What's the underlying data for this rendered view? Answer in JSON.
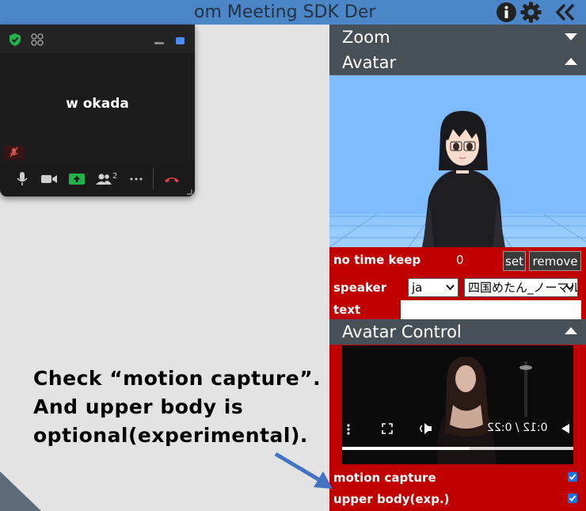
{
  "window": {
    "title": "om Meeting SDK Der",
    "icons": [
      "info-icon",
      "gear-icon",
      "double-chevron-left-icon"
    ]
  },
  "zoom_window": {
    "participant_name": "w okada",
    "participant_count": "2",
    "icons": [
      "shield-check-icon",
      "grid-view-icon",
      "minimize-icon",
      "maximize-icon",
      "muted-mic-icon",
      "mic-icon",
      "video-camera-icon",
      "share-screen-icon",
      "participants-icon",
      "more-icon",
      "end-call-icon"
    ],
    "colors": {
      "shield": "#22b24c",
      "share": "#22b24c",
      "end_call": "#e8453c"
    }
  },
  "panel": {
    "zoom_header": "Zoom",
    "avatar_header": "Avatar",
    "time_keep_label": "no time keep",
    "time_keep_value": "0",
    "set_button": "set",
    "remove_button": "remove",
    "speaker_label": "speaker",
    "speaker_lang": "ja",
    "speaker_voice": "四国めたん_ノーマル",
    "text_label": "text",
    "text_value": "",
    "avatar_control_header": "Avatar Control",
    "video_time": "0:12 / 0:22",
    "video_progress": 0.55,
    "motion_capture_label": "motion capture",
    "motion_capture_checked": true,
    "upper_body_label": "upper body(exp.)",
    "upper_body_checked": true,
    "colors": {
      "panel_bg": "#c00000",
      "header_bg": "#475057",
      "avatar_bg": "#7ebcff"
    }
  },
  "annotation": {
    "line1": "Check “motion capture”.",
    "line2": "And upper body is",
    "line3": "optional(experimental).",
    "arrow_color": "#4472c4"
  }
}
